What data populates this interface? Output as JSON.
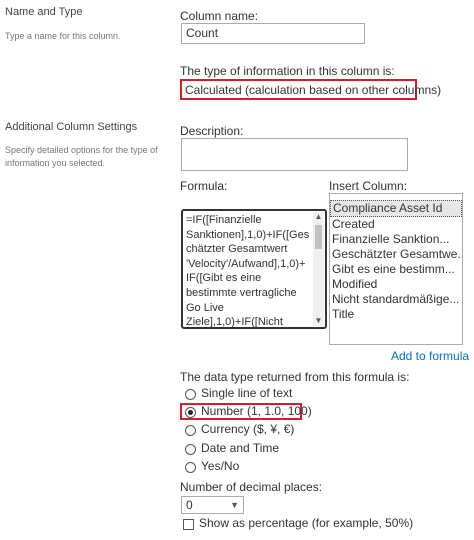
{
  "name_section": {
    "title": "Name and Type",
    "description": "Type a name for this column."
  },
  "column_name": {
    "label": "Column name:",
    "value": "Count"
  },
  "type_info": {
    "label": "The type of information in this column is:",
    "value": "Calculated (calculation based on other columns)"
  },
  "additional_section": {
    "title": "Additional Column Settings",
    "description": "Specify detailed options for the type of information you selected."
  },
  "description": {
    "label": "Description:",
    "value": ""
  },
  "formula": {
    "label": "Formula:",
    "lines": [
      "=IF([Finanzielle",
      "Sanktionen],1,0)+IF([Ges",
      "chätzter Gesamtwert",
      "'Velocity'/Aufwand],1,0)+",
      "IF([Gibt es eine",
      "bestimmte vertragliche",
      "Go Live",
      "Ziele],1,0)+IF([Nicht"
    ]
  },
  "insert_column": {
    "label": "Insert Column:",
    "items": [
      "Compliance Asset Id",
      "Created",
      "Finanzielle Sanktion...",
      "Geschätzter Gesamtwe...",
      "Gibt es eine bestimm...",
      "Modified",
      "Nicht standardmäßige...",
      "Title"
    ],
    "selected_index": 0,
    "add_link": "Add to formula"
  },
  "return_type": {
    "label": "The data type returned from this formula is:",
    "options": [
      "Single line of text",
      "Number (1, 1.0, 100)",
      "Currency ($, ¥, €)",
      "Date and Time",
      "Yes/No"
    ],
    "selected_index": 1
  },
  "decimal_places": {
    "label": "Number of decimal places:",
    "value": "0"
  },
  "percentage": {
    "label": "Show as percentage (for example, 50%)",
    "checked": false
  },
  "colors": {
    "highlight_border": "#d2202b",
    "link": "#0072c6"
  }
}
